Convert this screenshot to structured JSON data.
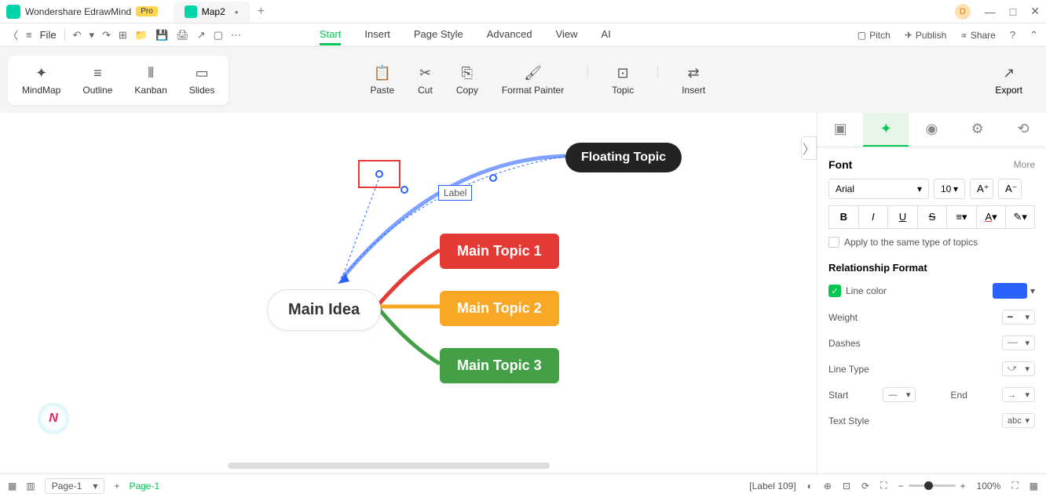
{
  "app": {
    "name": "Wondershare EdrawMind",
    "badge": "Pro",
    "user_initial": "D"
  },
  "tabs": {
    "active": "Map2",
    "close_glyph": "•",
    "add_glyph": "+"
  },
  "toolbar": {
    "file": "File"
  },
  "menu": {
    "start": "Start",
    "insert": "Insert",
    "page_style": "Page Style",
    "advanced": "Advanced",
    "view": "View",
    "ai": "AI"
  },
  "right_actions": {
    "pitch": "Pitch",
    "publish": "Publish",
    "share": "Share"
  },
  "views": {
    "mindmap": "MindMap",
    "outline": "Outline",
    "kanban": "Kanban",
    "slides": "Slides"
  },
  "actions": {
    "paste": "Paste",
    "cut": "Cut",
    "copy": "Copy",
    "format_painter": "Format Painter",
    "topic": "Topic",
    "insert": "Insert",
    "export": "Export"
  },
  "canvas": {
    "main_idea": "Main Idea",
    "topic1": "Main Topic 1",
    "topic2": "Main Topic 2",
    "topic3": "Main Topic 3",
    "floating": "Floating Topic",
    "label": "Label"
  },
  "panel": {
    "font_h": "Font",
    "more": "More",
    "font_name": "Arial",
    "font_size": "10",
    "apply_same": "Apply to the same type of topics",
    "rel_format": "Relationship Format",
    "line_color": "Line color",
    "weight": "Weight",
    "dashes": "Dashes",
    "line_type": "Line Type",
    "start": "Start",
    "end": "End",
    "text_style": "Text Style"
  },
  "status": {
    "page_sel": "Page-1",
    "page_active": "Page-1",
    "selection": "[Label 109]",
    "zoom": "100%"
  }
}
